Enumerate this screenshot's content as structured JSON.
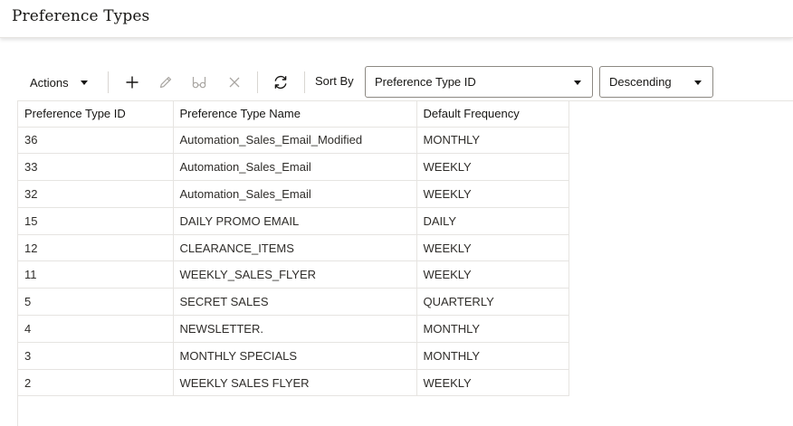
{
  "page": {
    "title": "Preference Types"
  },
  "toolbar": {
    "actions_label": "Actions",
    "icons": [
      "plus-icon",
      "pencil-icon",
      "glasses-icon",
      "close-icon",
      "refresh-icon"
    ],
    "sort_by_label": "Sort By",
    "sort_field": "Preference Type ID",
    "sort_order": "Descending"
  },
  "table": {
    "columns": [
      "Preference Type ID",
      "Preference Type Name",
      "Default Frequency"
    ],
    "rows": [
      [
        "36",
        "Automation_Sales_Email_Modified",
        "MONTHLY"
      ],
      [
        "33",
        "Automation_Sales_Email",
        "WEEKLY"
      ],
      [
        "32",
        "Automation_Sales_Email",
        "WEEKLY"
      ],
      [
        "15",
        "DAILY PROMO EMAIL",
        "DAILY"
      ],
      [
        "12",
        "CLEARANCE_ITEMS",
        "WEEKLY"
      ],
      [
        "11",
        "WEEKLY_SALES_FLYER",
        "WEEKLY"
      ],
      [
        "5",
        "SECRET SALES",
        "QUARTERLY"
      ],
      [
        "4",
        "NEWSLETTER.",
        "MONTHLY"
      ],
      [
        "3",
        "MONTHLY SPECIALS",
        "MONTHLY"
      ],
      [
        "2",
        "WEEKLY SALES FLYER",
        "WEEKLY"
      ]
    ]
  },
  "colors": {
    "text": "#161513",
    "border": "#e6e4e1",
    "icon_active": "#161513",
    "icon_disabled": "#a9a6a2"
  }
}
